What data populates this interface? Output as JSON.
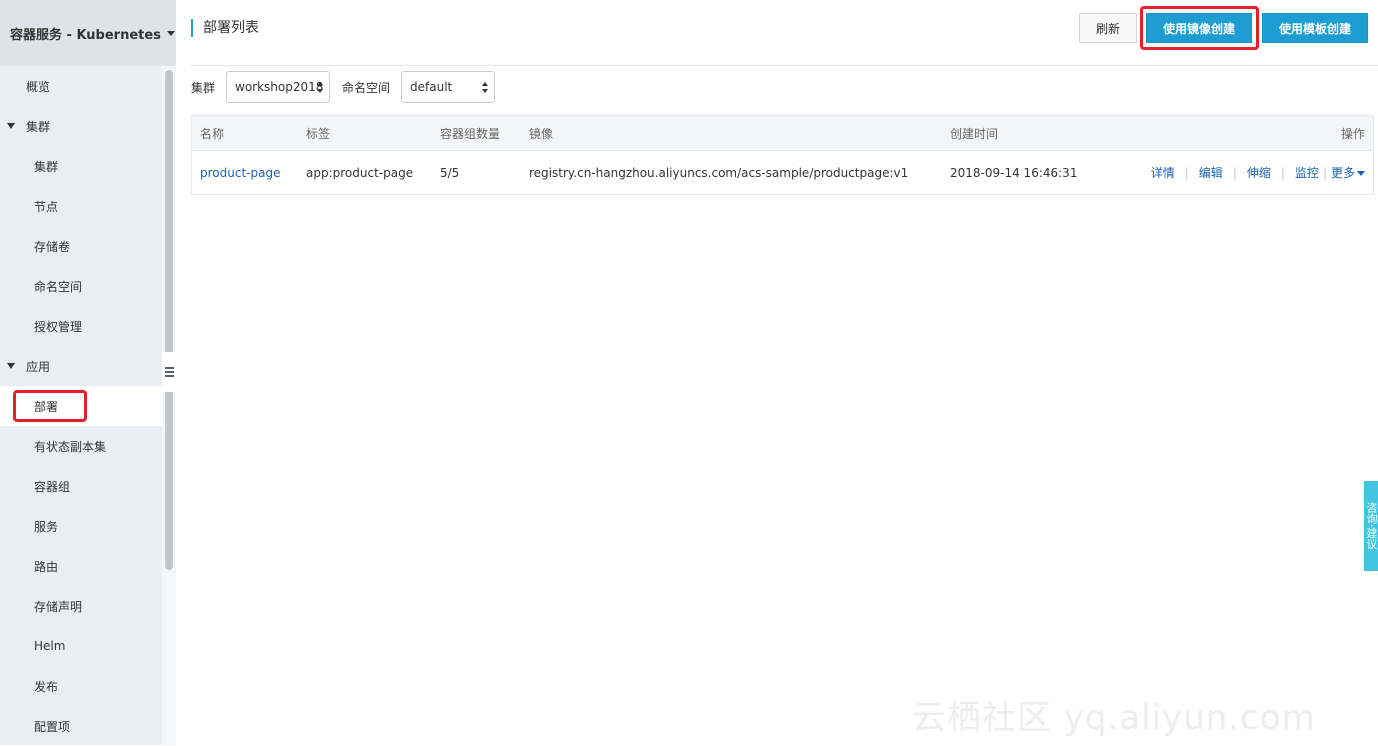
{
  "sidebar": {
    "header_title": "容器服务 - Kubernetes",
    "items": [
      {
        "label": "概览"
      },
      {
        "label": "集群"
      },
      {
        "label": "集群"
      },
      {
        "label": "节点"
      },
      {
        "label": "存储卷"
      },
      {
        "label": "命名空间"
      },
      {
        "label": "授权管理"
      },
      {
        "label": "应用"
      },
      {
        "label": "部署"
      },
      {
        "label": "有状态副本集"
      },
      {
        "label": "容器组"
      },
      {
        "label": "服务"
      },
      {
        "label": "路由"
      },
      {
        "label": "存储声明"
      },
      {
        "label": "Helm"
      },
      {
        "label": "发布"
      },
      {
        "label": "配置项"
      }
    ]
  },
  "header": {
    "title": "部署列表",
    "refresh_label": "刷新",
    "create_image_label": "使用镜像创建",
    "create_template_label": "使用模板创建"
  },
  "filters": {
    "cluster_label": "集群",
    "cluster_value": "workshop2018",
    "namespace_label": "命名空间",
    "namespace_value": "default"
  },
  "table": {
    "columns": [
      "名称",
      "标签",
      "容器组数量",
      "镜像",
      "创建时间",
      "操作"
    ],
    "rows": [
      {
        "name": "product-page",
        "label": "app:product-page",
        "pods": "5/5",
        "image": "registry.cn-hangzhou.aliyuncs.com/acs-sample/productpage:v1",
        "created": "2018-09-14 16:46:31",
        "actions": [
          "详情",
          "编辑",
          "伸缩",
          "监控",
          "更多"
        ]
      }
    ]
  },
  "float_tab": "咨询·建议",
  "watermark": "云栖社区 yq.aliyun.com",
  "colors": {
    "primary": "#1d9dd1",
    "highlight": "#e5202a",
    "link": "#1a62b4",
    "sidebar_bg": "#eaedf1"
  }
}
